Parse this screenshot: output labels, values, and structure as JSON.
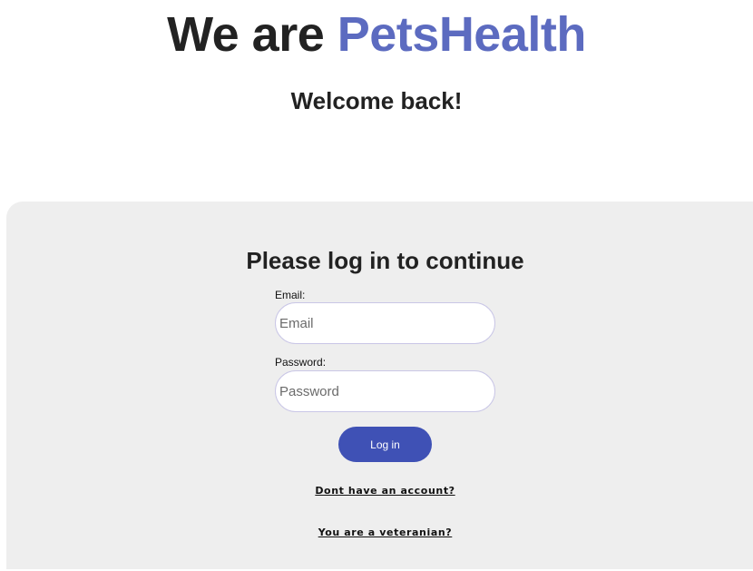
{
  "hero": {
    "title_prefix": "We are ",
    "brand_name": "PetsHealth",
    "subtitle": "Welcome back!"
  },
  "login_form": {
    "heading": "Please log in to continue",
    "email": {
      "label": "Email:",
      "placeholder": "Email",
      "value": ""
    },
    "password": {
      "label": "Password:",
      "placeholder": "Password",
      "value": ""
    },
    "submit_label": "Log in",
    "signup_link": "Dont have an account?",
    "veterinarian_link": "You are a veteranian?"
  },
  "colors": {
    "brand_accent": "#5c6bc0",
    "button_background": "#3f51b5",
    "card_background": "#eeeeee",
    "input_border": "#c9c6e6"
  }
}
